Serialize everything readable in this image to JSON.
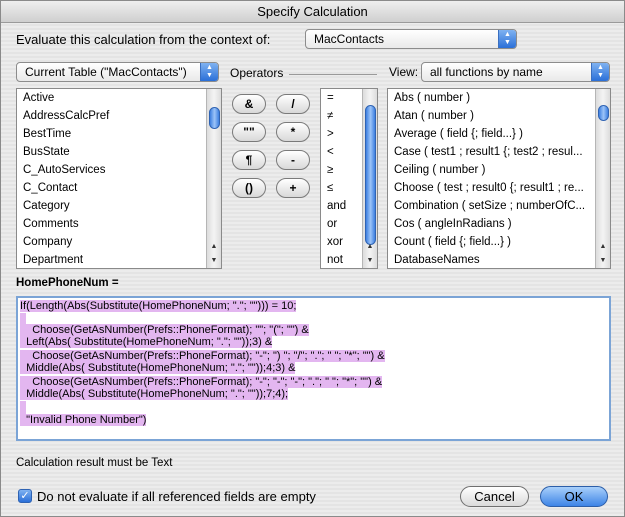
{
  "window": {
    "title": "Specify Calculation"
  },
  "context": {
    "label": "Evaluate this calculation from the context of:",
    "selected": "MacContacts"
  },
  "table_popup": {
    "selected": "Current Table (\"MacContacts\")"
  },
  "operators": {
    "label": "Operators",
    "buttons": [
      "&",
      "/",
      "\"\"",
      "*",
      "¶",
      "-",
      "()",
      "+"
    ],
    "list": [
      "=",
      "≠",
      ">",
      "<",
      "≥",
      "≤",
      "and",
      "or",
      "xor",
      "not"
    ]
  },
  "view": {
    "label": "View:",
    "selected": "all functions by name"
  },
  "fields": [
    "Active",
    "AddressCalcPref",
    "BestTime",
    "BusState",
    "C_AutoServices",
    "C_Contact",
    "Category",
    "Comments",
    "Company",
    "Department"
  ],
  "functions": [
    "Abs ( number )",
    "Atan ( number )",
    "Average ( field {; field...} )",
    "Case ( test1 ; result1 {; test2 ; resul...",
    "Ceiling ( number )",
    "Choose ( test ; result0 {; result1 ; re...",
    "Combination ( setSize ; numberOfC...",
    "Cos ( angleInRadians )",
    "Count ( field {; field...} )",
    "DatabaseNames"
  ],
  "calc_field_label": "HomePhoneNum =",
  "formula_lines": [
    "If(Length(Abs(Substitute(HomePhoneNum; \".\"; \"\"))) = 10;",
    "",
    "    Choose(GetAsNumber(Prefs::PhoneFormat); \"\"; \"(\"; \"\") &",
    "  Left(Abs( Substitute(HomePhoneNum; \".\"; \"\"));3) &",
    "    Choose(GetAsNumber(Prefs::PhoneFormat); \"-\"; \") \"; \"/\"; \".\"; \" \"; \"*\"; \"\") &",
    "  Middle(Abs( Substitute(HomePhoneNum; \".\"; \"\"));4;3) &",
    "    Choose(GetAsNumber(Prefs::PhoneFormat); \"-\"; \"-\"; \"-\"; \".\"; \" \"; \"*\"; \"\") &",
    "  Middle(Abs( Substitute(HomePhoneNum; \".\"; \"\"));7;4);",
    "",
    "  \"Invalid Phone Number\")"
  ],
  "result_type": "Calculation result must be Text",
  "dont_evaluate": {
    "label": "Do not evaluate if all referenced fields are empty",
    "checked": true
  },
  "buttons": {
    "cancel": "Cancel",
    "ok": "OK"
  }
}
